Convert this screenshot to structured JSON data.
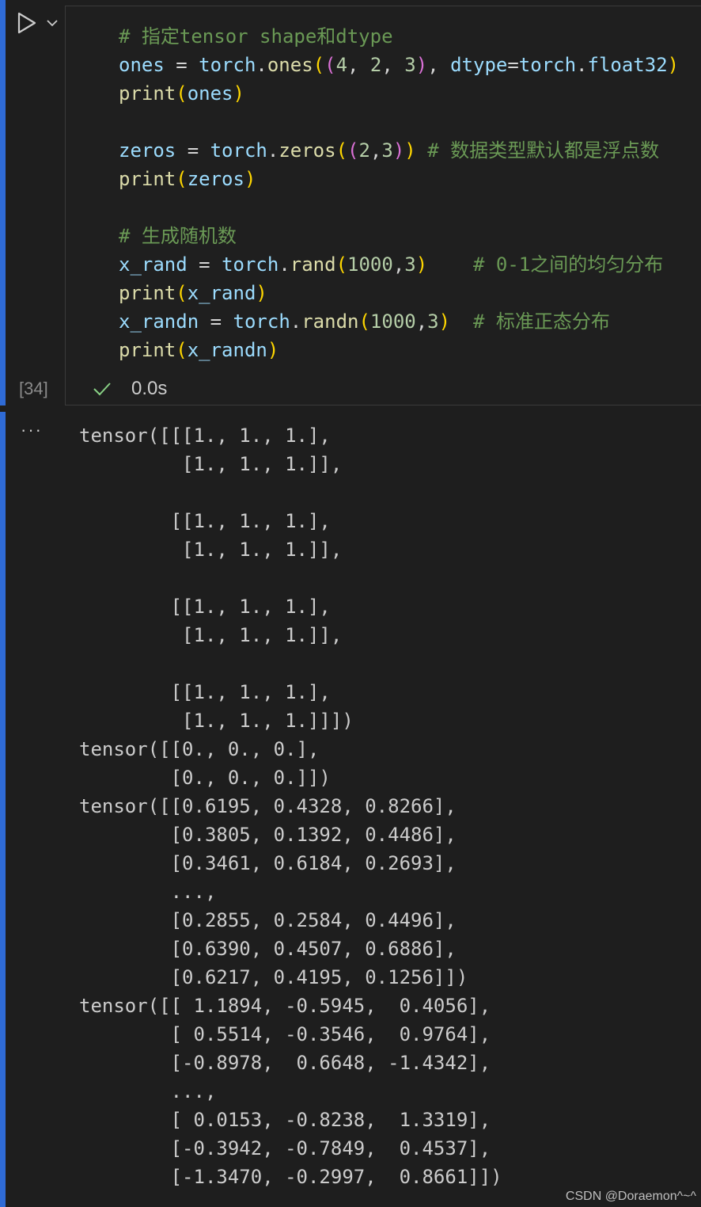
{
  "code_lines": [
    "# 指定tensor shape和dtype",
    "ones = torch.ones((4, 2, 3), dtype=torch.float32)",
    "print(ones)",
    "",
    "zeros = torch.zeros((2,3)) # 数据类型默认都是浮点数",
    "print(zeros)",
    "",
    "# 生成随机数",
    "x_rand = torch.rand(1000,3)    # 0-1之间的均匀分布",
    "print(x_rand)",
    "x_randn = torch.randn(1000,3)  # 标准正态分布",
    "print(x_randn)"
  ],
  "cell": {
    "execution_count": "[34]",
    "exec_time": "0.0s",
    "more_actions": "···"
  },
  "output_lines": [
    "tensor([[[1., 1., 1.],",
    "         [1., 1., 1.]],",
    "",
    "        [[1., 1., 1.],",
    "         [1., 1., 1.]],",
    "",
    "        [[1., 1., 1.],",
    "         [1., 1., 1.]],",
    "",
    "        [[1., 1., 1.],",
    "         [1., 1., 1.]]])",
    "tensor([[0., 0., 0.],",
    "        [0., 0., 0.]])",
    "tensor([[0.6195, 0.4328, 0.8266],",
    "        [0.3805, 0.1392, 0.4486],",
    "        [0.3461, 0.6184, 0.2693],",
    "        ...,",
    "        [0.2855, 0.2584, 0.4496],",
    "        [0.6390, 0.4507, 0.6886],",
    "        [0.6217, 0.4195, 0.1256]])",
    "tensor([[ 1.1894, -0.5945,  0.4056],",
    "        [ 0.5514, -0.3546,  0.9764],",
    "        [-0.8978,  0.6648, -1.4342],",
    "        ...,",
    "        [ 0.0153, -0.8238,  1.3319],",
    "        [-0.3942, -0.7849,  0.4537],",
    "        [-1.3470, -0.2997,  0.8661]])"
  ],
  "watermark": "CSDN @Doraemon^~^",
  "colors": {
    "accent_bar": "#2f6bd6",
    "comment": "#6a9955",
    "variable": "#9cdcfe",
    "function": "#dcdcaa",
    "number": "#b5cea8",
    "success": "#89d185"
  }
}
